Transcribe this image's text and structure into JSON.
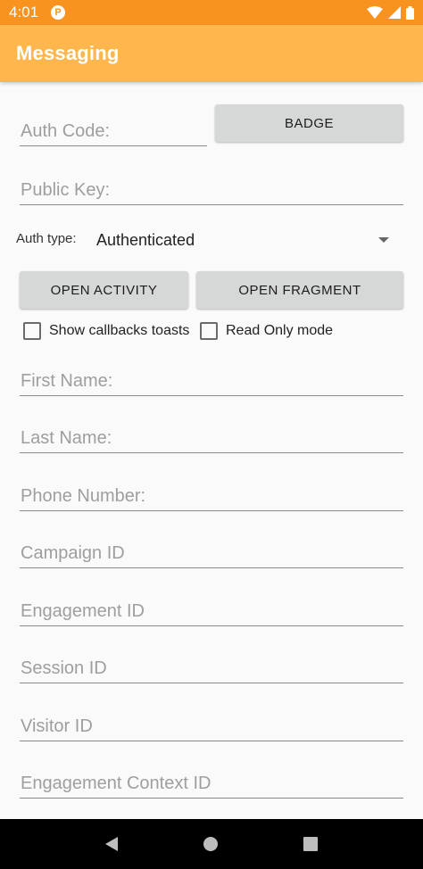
{
  "status_bar": {
    "time": "4:01",
    "app_icon_glyph": "P",
    "icons": [
      "wifi-icon",
      "signal-icon",
      "battery-icon"
    ]
  },
  "app_bar": {
    "title": "Messaging"
  },
  "auth": {
    "auth_code_placeholder": "Auth Code:",
    "badge_label": "BADGE",
    "public_key_placeholder": "Public Key:",
    "auth_type_label": "Auth type:",
    "auth_type_value": "Authenticated"
  },
  "actions": {
    "open_activity_label": "OPEN ACTIVITY",
    "open_fragment_label": "OPEN FRAGMENT"
  },
  "options": {
    "show_callbacks_label": "Show callbacks toasts",
    "read_only_label": "Read Only mode"
  },
  "form": {
    "first_name": "First Name:",
    "last_name": "Last Name:",
    "phone_number": "Phone Number:",
    "campaign_id": "Campaign ID",
    "engagement_id": "Engagement ID",
    "session_id": "Session ID",
    "visitor_id": "Visitor ID",
    "engagement_context_id": "Engagement Context ID"
  },
  "colors": {
    "status_bar": "#f7931e",
    "app_bar": "#ffb74d",
    "button": "#d6d7d7",
    "background": "#fafafa"
  }
}
